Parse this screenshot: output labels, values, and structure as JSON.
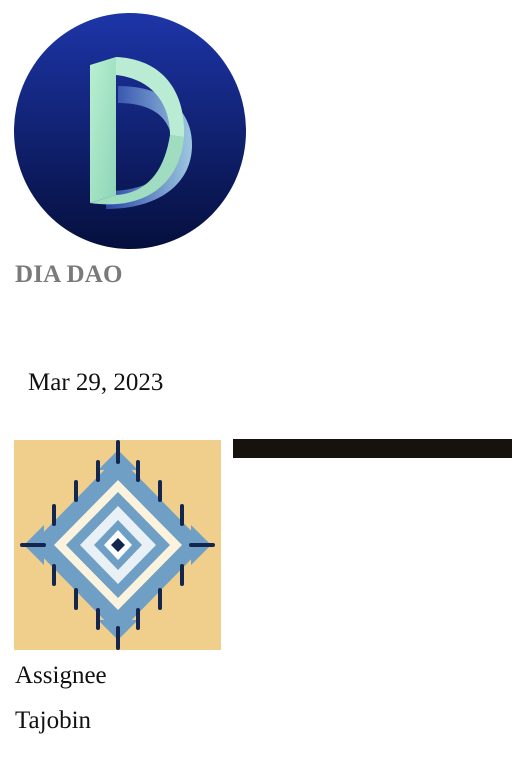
{
  "organization": {
    "logo_icon": "dia-dao-logo-icon",
    "name": "DIA DAO"
  },
  "date": "Mar 29, 2023",
  "card": {
    "image_icon": "tribal-diamond-pattern-icon"
  },
  "assignee": {
    "label": "Assignee",
    "value": "Tajobin"
  },
  "colors": {
    "logo_bg_top": "#1d35a8",
    "logo_bg_bottom": "#050f3d",
    "logo_letter": "#a8e6c8",
    "org_name": "#7a7a7a",
    "pattern_bg": "#f0cf8c",
    "pattern_blue": "#6f9fc4",
    "pattern_navy": "#14264d",
    "dark_bar": "#16120e"
  }
}
